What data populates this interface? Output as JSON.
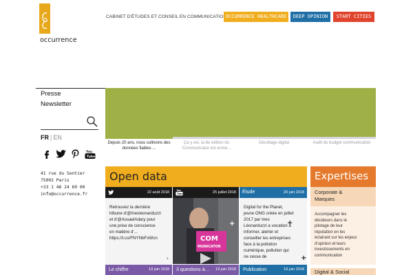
{
  "header": {
    "logo_text": "occurrence",
    "tagline": "CABINET D'ÉTUDES ET CONSEIL EN COMMUNICATION",
    "buttons": [
      {
        "label": "OCCURRENCE HEALTHCARE",
        "color": "#f0ad1e"
      },
      {
        "label": "DEEP OPINION",
        "color": "#1f6fa6"
      },
      {
        "label": "START CITIES",
        "color": "#e0442d"
      }
    ]
  },
  "sidebar": {
    "links": [
      "Presse",
      "Newsletter"
    ],
    "lang": {
      "fr": "FR",
      "sep": "|",
      "en": "EN"
    },
    "social_icons": [
      "facebook-icon",
      "twitter-icon",
      "pinterest-icon",
      "youtube-icon"
    ],
    "address": [
      "41 rue du Sentier",
      "75002 Paris",
      "+33 1 48 24 69 00",
      "info@occurrence.fr"
    ]
  },
  "hero": {
    "color": "#9eb046",
    "tabs": [
      {
        "text": "Depuis 20 ans, nous cultivons des données fiables ..."
      },
      {
        "text": "Ça y est, la 8e édition du Communicator est arrivé..."
      },
      {
        "text": "Décollage digital"
      },
      {
        "text": "Audit du budget communication"
      }
    ]
  },
  "open_data": {
    "title": "Open data",
    "cards": [
      {
        "icon": "twitter-icon",
        "date": "22 août 2018",
        "text": [
          "Retrouvez la dernière",
          "tribune d'@Inesleonarduzzi",
          "et d'@AssaelAdary pour",
          "une prise de conscience",
          "en matière d'...",
          "https://t.co/FNYNbFxWcn"
        ]
      },
      {
        "icon": "youtube-icon",
        "date": "25 juillet 2018",
        "image_text": [
          "COM",
          "MUNICATOR"
        ]
      },
      {
        "category": "Étude",
        "date": "20 juin 2018",
        "text": [
          "Digital for the Planet,",
          "jeune ONG créée en juillet",
          "2017 par Ines",
          "Léonarduzzi a vocation à",
          "informer, alerter et",
          "conseiller les entreprises",
          "face à la pollution",
          "numérique, pollution qui",
          "ne cesse de"
        ]
      }
    ],
    "bottom_tabs": [
      {
        "label": "Le chiffre",
        "date": "19 juin 2018",
        "color": "#7a5aa6"
      },
      {
        "label": "3 questions à...",
        "date": "19 juin 2018",
        "color": "#7a5aa6"
      },
      {
        "label": "Publication",
        "date": "19 juin 2018",
        "color": "#1f6fa6"
      }
    ]
  },
  "expertises": {
    "title": "Expertises",
    "items": [
      {
        "title": "Corporate & Marques",
        "description": [
          "Accompagner les",
          "décideurs dans le",
          "pilotage de leur",
          "réputation en les",
          "éclairant sur les enjeux",
          "d'opinion et leurs",
          "investissements en",
          "communication"
        ]
      },
      {
        "title": "Digital & Social"
      }
    ]
  }
}
